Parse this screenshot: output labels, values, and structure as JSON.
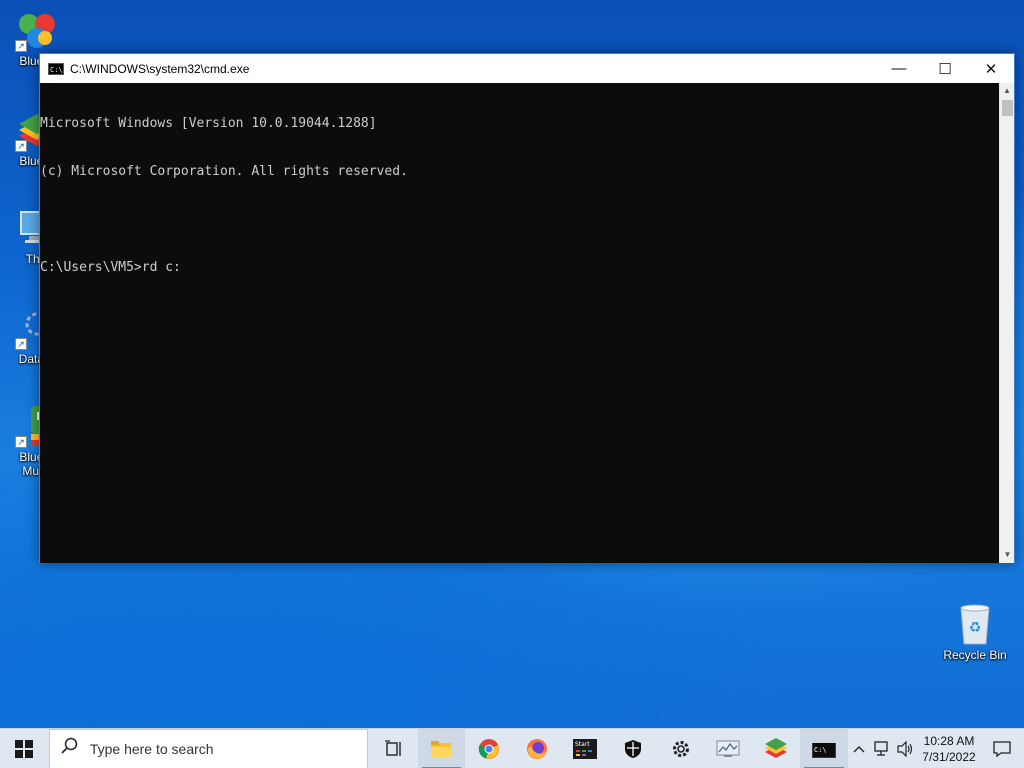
{
  "desktop": {
    "icons": [
      {
        "label": "BlueSt"
      },
      {
        "label": "BlueSt"
      },
      {
        "label": "This"
      },
      {
        "label": "DataW"
      },
      {
        "label": "BlueSt\nMulti-"
      },
      {
        "label": "Recycle Bin"
      }
    ]
  },
  "window": {
    "title": "C:\\WINDOWS\\system32\\cmd.exe",
    "icon_text": "C:\\",
    "minimize_glyph": "—",
    "maximize_glyph": "☐",
    "close_glyph": "✕",
    "console_lines": [
      "Microsoft Windows [Version 10.0.19044.1288]",
      "(c) Microsoft Corporation. All rights reserved.",
      "",
      "C:\\Users\\VM5>rd c:"
    ]
  },
  "taskbar": {
    "search_placeholder": "Type here to search",
    "clock_time": "10:28 AM",
    "clock_date": "7/31/2022"
  },
  "colors": {
    "console_bg": "#0c0c0c",
    "console_fg": "#cccccc",
    "taskbar_bg": "#dfe7f1"
  }
}
